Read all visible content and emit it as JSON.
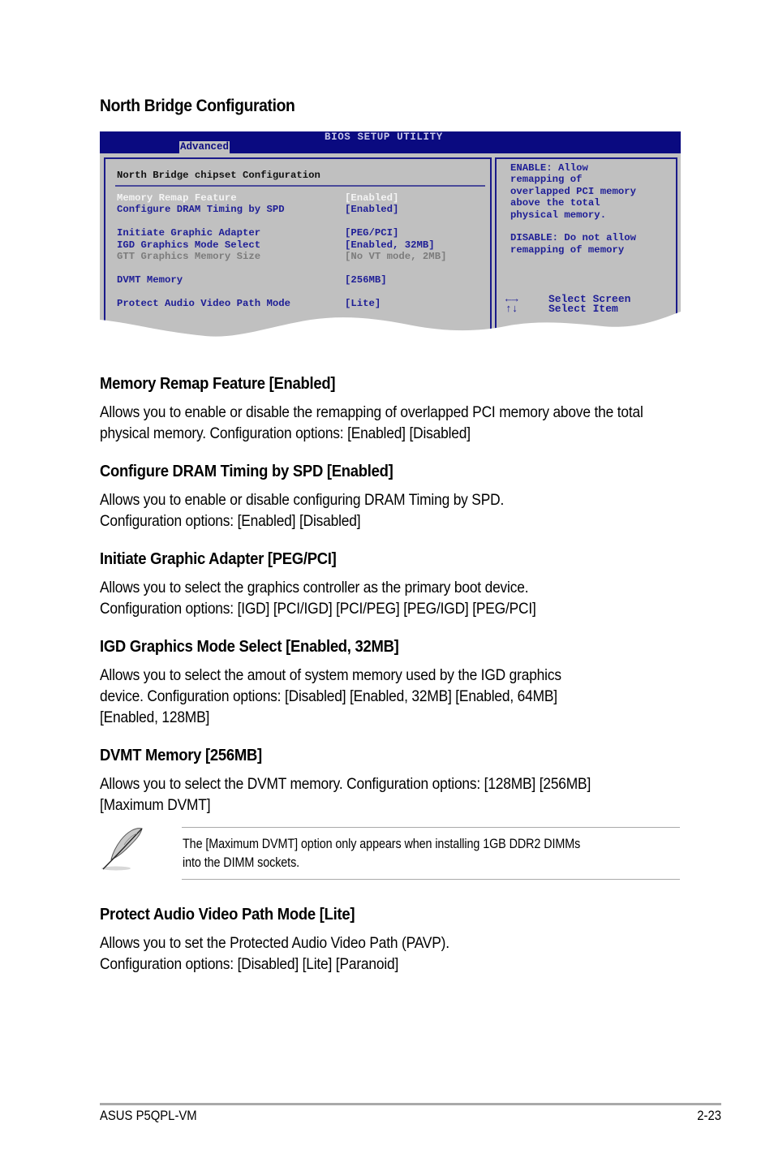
{
  "page_title": "North Bridge Configuration",
  "bios": {
    "title": "BIOS SETUP UTILITY",
    "active_tab": "Advanced",
    "panel_heading": "North Bridge chipset Configuration",
    "items": [
      {
        "label": "Memory Remap Feature",
        "value": "[Enabled]",
        "state": "selected"
      },
      {
        "label": "Configure DRAM Timing by SPD",
        "value": "[Enabled]",
        "state": "normal"
      },
      {
        "label": "Initiate Graphic Adapter",
        "value": "[PEG/PCI]",
        "state": "normal"
      },
      {
        "label": "IGD Graphics Mode Select",
        "value": "[Enabled, 32MB]",
        "state": "normal"
      },
      {
        "label": "GTT Graphics Memory Size",
        "value": "[No VT mode, 2MB]",
        "state": "disabled"
      },
      {
        "label": "DVMT Memory",
        "value": "[256MB]",
        "state": "normal"
      },
      {
        "label": "Protect Audio Video Path Mode",
        "value": "[Lite]",
        "state": "normal"
      }
    ],
    "help_lines": [
      "ENABLE: Allow",
      "remapping of",
      "overlapped PCI memory",
      "above the total",
      "physical memory.",
      "DISABLE: Do not allow",
      "remapping of memory"
    ],
    "keys": [
      {
        "key": "←→",
        "action": "Select Screen"
      },
      {
        "key": "↑↓",
        "action": "Select Item"
      }
    ],
    "colors": {
      "title_bar": "#0a0a80",
      "panel_bg": "#c0c0c0",
      "item_text": "#1e1e96",
      "selected_text": "#f4f4f4",
      "disabled_text": "#7c7c7c"
    }
  },
  "sections": [
    {
      "heading": "Memory Remap Feature [Enabled]",
      "body": "Allows you to enable or disable the  remapping of overlapped PCI memory above the total physical memory. Configuration options: [Enabled] [Disabled]"
    },
    {
      "heading": "Configure DRAM Timing by SPD [Enabled]",
      "body_lines": [
        "Allows you to enable or disable configuring DRAM Timing by SPD.",
        "Configuration options: [Enabled] [Disabled]"
      ]
    },
    {
      "heading": "Initiate Graphic Adapter [PEG/PCI]",
      "body_lines": [
        "Allows you to select the graphics controller as the primary boot device.",
        "Configuration options: [IGD] [PCI/IGD] [PCI/PEG] [PEG/IGD] [PEG/PCI]"
      ]
    },
    {
      "heading": "IGD Graphics Mode Select [Enabled, 32MB]",
      "body_lines": [
        "Allows you to select the amout of system memory used by the IGD graphics",
        "device. Configuration options: [Disabled] [Enabled, 32MB] [Enabled, 64MB]",
        "[Enabled, 128MB]"
      ]
    },
    {
      "heading": "DVMT Memory [256MB]",
      "body_lines": [
        "Allows you to select the  DVMT memory. Configuration options: [128MB] [256MB]",
        "[Maximum DVMT]"
      ]
    },
    {
      "heading": "Protect Audio Video Path Mode [Lite]",
      "body_lines": [
        "Allows you to set the Protected Audio Video Path (PAVP).",
        "Configuration options: [Disabled] [Lite] [Paranoid]"
      ]
    }
  ],
  "note": {
    "icon": "feather-pen-icon",
    "lines": [
      "The [Maximum DVMT] option only appears when installing 1GB DDR2 DIMMs",
      "into the DIMM sockets."
    ]
  },
  "footer": {
    "product": "ASUS P5QPL-VM",
    "page_number": "2-23"
  }
}
